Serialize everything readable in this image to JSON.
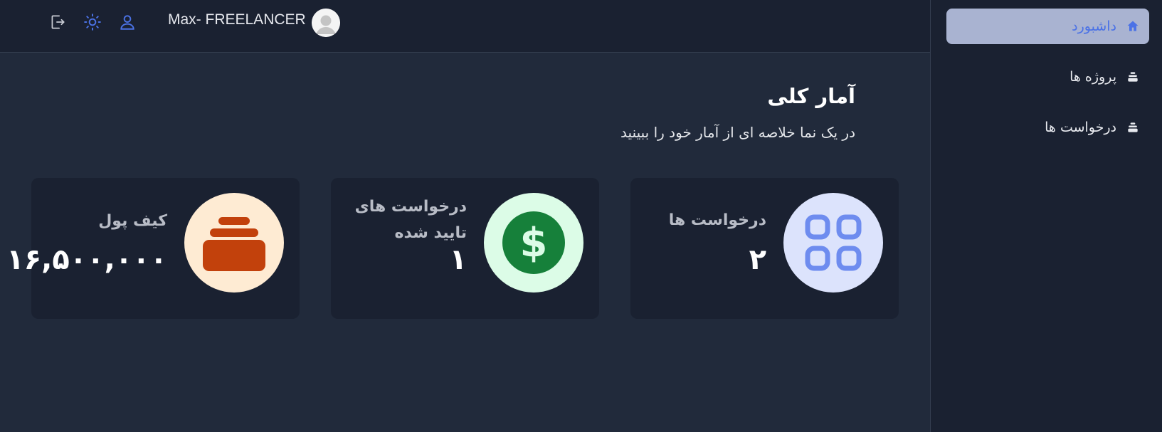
{
  "sidebar": {
    "items": [
      {
        "label": "داشبورد",
        "icon": "home-icon",
        "active": true
      },
      {
        "label": "پروژه ها",
        "icon": "stack-icon",
        "active": false
      },
      {
        "label": "درخواست ها",
        "icon": "stack-icon",
        "active": false
      }
    ]
  },
  "header": {
    "user_name": "Max- FREELANCER",
    "icons": [
      "logout-icon",
      "sun-icon",
      "user-icon"
    ]
  },
  "main": {
    "title": "آمار کلی",
    "subtitle": "در یک نما خلاصه ای از آمار خود را ببینید",
    "cards": [
      {
        "label": "درخواست ها",
        "value": "۲",
        "icon": "grid-icon"
      },
      {
        "label": "درخواست های تایید شده",
        "value": "۱",
        "icon": "dollar-icon"
      },
      {
        "label": "کیف پول",
        "value": "۱۶,۵۰۰,۰۰۰",
        "icon": "wallet-icon"
      }
    ]
  },
  "colors": {
    "accent": "#4b72e6",
    "active_nav_bg": "#a9b3d1",
    "card_bg": "#1a2131",
    "page_bg": "#212a3b"
  }
}
